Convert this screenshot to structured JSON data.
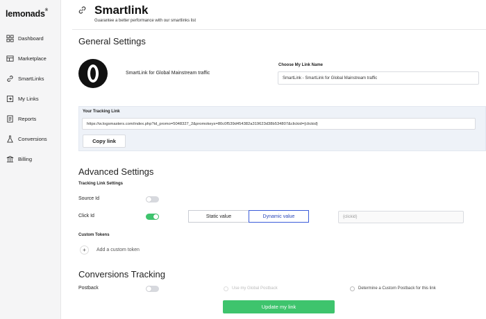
{
  "sidebar": {
    "logo": "lemonads",
    "logo_mark": "®",
    "items": [
      {
        "label": "Dashboard",
        "icon": "dashboard-icon"
      },
      {
        "label": "Marketplace",
        "icon": "marketplace-icon"
      },
      {
        "label": "SmartLinks",
        "icon": "link-icon"
      },
      {
        "label": "My Links",
        "icon": "links-icon"
      },
      {
        "label": "Reports",
        "icon": "reports-icon"
      },
      {
        "label": "Conversions",
        "icon": "conversions-icon"
      },
      {
        "label": "Billing",
        "icon": "billing-icon"
      }
    ]
  },
  "header": {
    "title": "Smartlink",
    "subtitle": "Guarantee a better performance with our smartlinks list"
  },
  "general": {
    "title": "General Settings",
    "offer_name": "SmartLink for Global Mainstream traffic",
    "link_name_label": "Choose My Link Name",
    "link_name_value": "SmartLink - SmartLink for Global Mainstream traffic"
  },
  "tracking": {
    "label": "Your Tracking Link",
    "url": "https://w.logsmasters.com/index.php?id_promo=5048327_2&promokeys=80c0f539d454382a319623d38b534807&clickid={clickid}",
    "copy_label": "Copy link"
  },
  "advanced": {
    "title": "Advanced Settings",
    "subtitle": "Tracking Link Settings",
    "source_id_label": "Source Id",
    "source_id_on": false,
    "click_id_label": "Click Id",
    "click_id_on": true,
    "static_label": "Static value",
    "dynamic_label": "Dynamic value",
    "click_id_placeholder": "{clickid}",
    "custom_tokens_label": "Custom Tokens",
    "add_token_label": "Add a custom token"
  },
  "conversions": {
    "title": "Conversions Tracking",
    "postback_label": "Postback",
    "postback_on": false,
    "global_postback_label": "Use my Global Postback",
    "custom_postback_label": "Determine a Custom Postback for this link",
    "update_label": "Update my link"
  },
  "colors": {
    "accent_green": "#3ec46d",
    "active_blue": "#2a47b8"
  }
}
